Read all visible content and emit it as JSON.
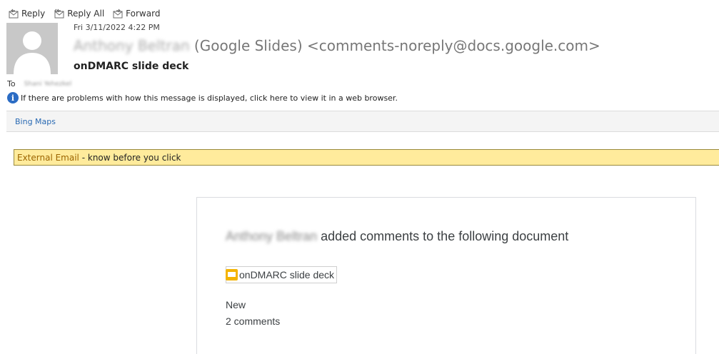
{
  "toolbar": {
    "reply_label": "Reply",
    "reply_all_label": "Reply All",
    "forward_label": "Forward",
    "icon_color": "#6b6b6b"
  },
  "message": {
    "date": "Fri 3/11/2022 4:22 PM",
    "sender_name": "Anthony Beltran",
    "sender_suffix": "(Google Slides) <comments-noreply@docs.google.com>",
    "subject": "onDMARC slide deck",
    "to_label": "To",
    "recipient": "Shani Yehezkel",
    "info_text": "If there are problems with how this message is displayed, click here to view it in a web browser."
  },
  "addin": {
    "bing_maps_label": "Bing Maps"
  },
  "banner": {
    "external_label": "External Email",
    "rest_text": " - know before you click",
    "background": "#ffeb9c"
  },
  "card": {
    "actor_name": "Anthony Beltran",
    "headline_rest": " added comments to the following document",
    "document_title": "onDMARC slide deck",
    "new_label": "New",
    "comments_count": "2 comments",
    "slides_icon_color": "#f4b400"
  }
}
